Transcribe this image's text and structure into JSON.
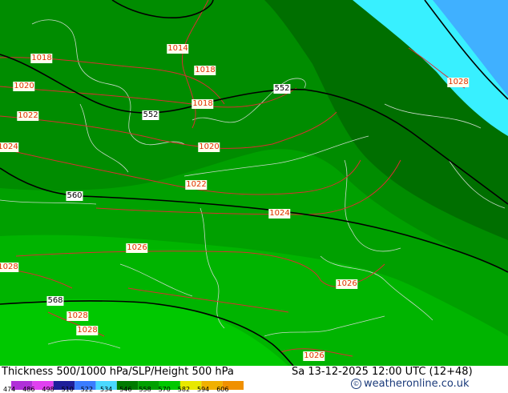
{
  "map": {
    "pressure_labels": [
      "1014",
      "1018",
      "1018",
      "1018",
      "1020",
      "1022",
      "1020",
      "1022",
      "1024",
      "1026",
      "1026",
      "1028",
      "1028",
      "1026",
      "1028",
      "1024",
      "1028"
    ],
    "height_labels": [
      "552",
      "552",
      "560",
      "568"
    ]
  },
  "info": {
    "title": "Thickness 500/1000 hPa/SLP/Height 500 hPa",
    "date": "Sa 13-12-2025 12:00 UTC (12+48)",
    "credit": "weatheronline.co.uk",
    "credit_symbol": "©"
  },
  "scale": {
    "values": [
      "474",
      "486",
      "498",
      "510",
      "522",
      "534",
      "546",
      "558",
      "570",
      "582",
      "594",
      "606"
    ],
    "colors": [
      "#b030d8",
      "#e040f0",
      "#1e1e9a",
      "#3a7cff",
      "#4ad8ff",
      "#007a00",
      "#00a000",
      "#00c800",
      "#e8e800",
      "#f0b000",
      "#f09000"
    ]
  },
  "colors": {
    "dark_green": "#006f00",
    "mid_green": "#008c00",
    "green": "#00a000",
    "light_green": "#00b400",
    "bright_green": "#00c800",
    "cyan": "#38f0ff",
    "blue": "#40b0ff",
    "isobar": "#d83030",
    "contour": "#000000",
    "label_bg": "#fffff0",
    "height_label_bg": "#ffffff",
    "label_fg_pressure": "#e03000"
  }
}
